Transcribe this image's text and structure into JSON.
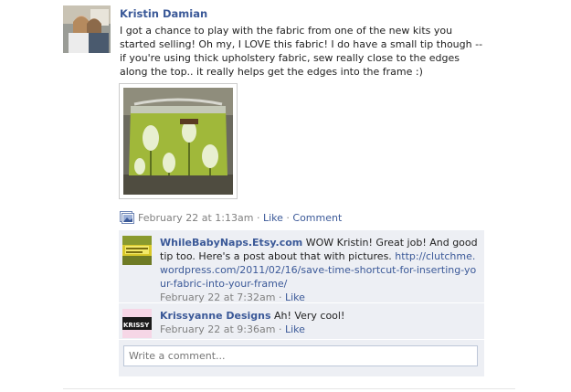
{
  "post": {
    "author": "Kristin Damian",
    "text": "I got a chance to play with the fabric from one of the new kits you started selling! Oh my, I LOVE this fabric! I do have a small tip though -- if you're using thick upholstery fabric, sew really close to the edges along the top.. it really helps get the edges into the frame :)",
    "timestamp": "February 22 at 1:13am",
    "separator": " · ",
    "like_label": "Like",
    "comment_label": "Comment",
    "icon": "photo-icon"
  },
  "comments": [
    {
      "name": "WhileBabyNaps.Etsy.com",
      "text": " WOW Kristin! Great job! And good tip too. Here's a post about that with pictures. ",
      "url": "http://clutchme.wordpress.com/2011/02/16/save-time-shortcut-for-inserting-your-fabric-into-your-frame/",
      "timestamp": "February 22 at 7:32am",
      "like_label": "Like"
    },
    {
      "name": "Krissyanne Designs",
      "text": " Ah! Very cool!",
      "url": "",
      "timestamp": "February 22 at 9:36am",
      "like_label": "Like",
      "avatar_text": "KRISSY"
    }
  ],
  "write_comment": {
    "placeholder": "Write a comment..."
  },
  "colors": {
    "link": "#3b5998",
    "comment_bg": "#edeff4",
    "meta": "#808080"
  }
}
